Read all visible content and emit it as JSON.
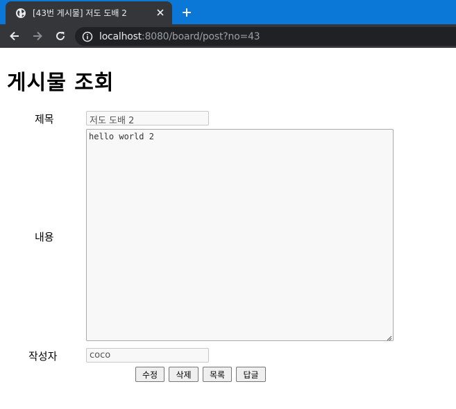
{
  "browser": {
    "tab_title": "[43번 게시물] 저도 도배 2",
    "url_host": "localhost",
    "url_rest": ":8080/board/post?no=43",
    "chrome_color": "#35363a",
    "tabstrip_color": "#0b78d7"
  },
  "page": {
    "title": "게시물 조회",
    "form": {
      "title_label": "제목",
      "title_value": "저도 도배 2",
      "content_label": "내용",
      "content_value": "hello world 2",
      "writer_label": "작성자",
      "writer_value": "coco"
    },
    "buttons": {
      "edit": "수정",
      "delete": "삭제",
      "list": "목록",
      "reply": "답글"
    }
  }
}
